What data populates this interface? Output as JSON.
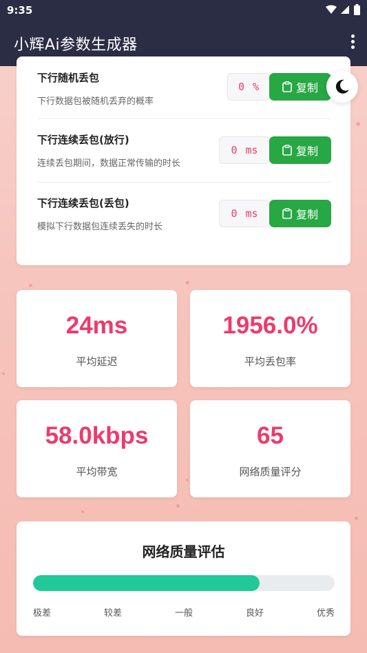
{
  "status_bar": {
    "time": "9:35"
  },
  "app_bar": {
    "title": "小辉Ai参数生成器"
  },
  "params": [
    {
      "title": "下行随机丢包",
      "desc": "下行数据包被随机丢弃的概率",
      "value": "0",
      "unit": "%",
      "copy_label": "复制"
    },
    {
      "title": "下行连续丢包(放行)",
      "desc": "连续丢包期间，数据正常传输的时长",
      "value": "0",
      "unit": "ms",
      "copy_label": "复制"
    },
    {
      "title": "下行连续丢包(丢包)",
      "desc": "模拟下行数据包连续丢失的时长",
      "value": "0",
      "unit": "ms",
      "copy_label": "复制"
    }
  ],
  "stats": [
    {
      "value": "24ms",
      "label": "平均延迟"
    },
    {
      "value": "1956.0%",
      "label": "平均丢包率"
    },
    {
      "value": "58.0kbps",
      "label": "平均带宽"
    },
    {
      "value": "65",
      "label": "网络质量评分"
    }
  ],
  "evaluation": {
    "title": "网络质量评估",
    "progress_fraction": 0.75,
    "scale": [
      "极差",
      "较差",
      "一般",
      "良好",
      "优秀"
    ]
  },
  "colors": {
    "accent": "#ee3a6b",
    "copy_button": "#28a745",
    "progress": "#20c997",
    "app_bar": "#2b2d44"
  }
}
